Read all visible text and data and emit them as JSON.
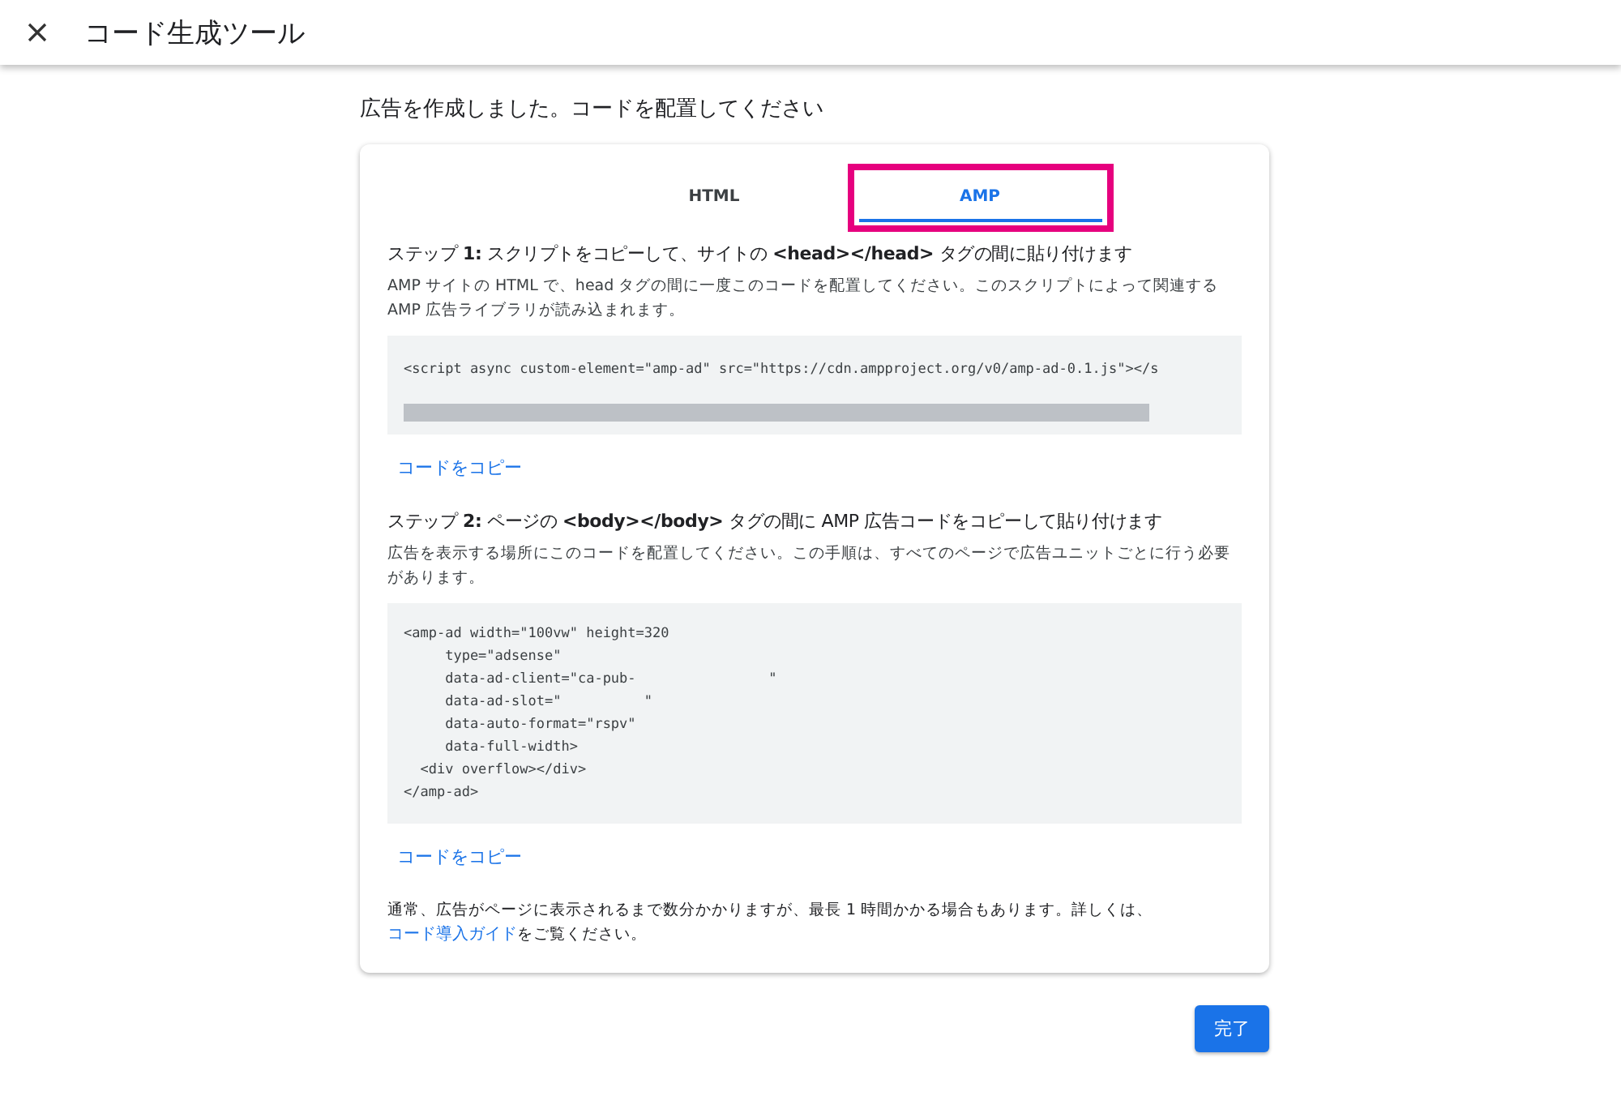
{
  "window": {
    "title": "コード生成ツール"
  },
  "heading": "広告を作成しました。コードを配置してください",
  "tabs": [
    {
      "label": "HTML",
      "selected": false,
      "highlighted": false
    },
    {
      "label": "AMP",
      "selected": true,
      "highlighted": true
    }
  ],
  "steps": [
    {
      "title": "ステップ **1:** スクリプトをコピーして、サイトの **<head></head>** タグの間に貼り付けます",
      "description": "AMP サイトの HTML で、head タグの間に一度このコードを配置してください。このスクリプトによって関連する AMP 広告ライブラリが読み込まれます。",
      "code": "<script async custom-element=\"amp-ad\" src=\"https://cdn.ampproject.org/v0/amp-ad-0.1.js\"></s",
      "scrollable": true,
      "copy_link": "コードをコピー"
    },
    {
      "title": "ステップ **2:** ページの **<body></body>** タグの間に AMP 広告コードをコピーして貼り付けます",
      "description": "広告を表示する場所にこのコードを配置してください。この手順は、すべてのページで広告ユニットごとに行う必要があります。",
      "code": "<amp-ad width=\"100vw\" height=320\n     type=\"adsense\"\n     data-ad-client=\"ca-pub-                \"\n     data-ad-slot=\"          \"\n     data-auto-format=\"rspv\"\n     data-full-width>\n  <div overflow></div>\n</amp-ad>",
      "scrollable": false,
      "copy_link": "コードをコピー"
    }
  ],
  "note": {
    "text": "通常、広告がページに表示されるまで数分かかりますが、最長 1 時間かかる場合もあります。詳しくは、",
    "link": "コード導入ガイド",
    "after": "をご覧ください。"
  },
  "done_button": "完了"
}
